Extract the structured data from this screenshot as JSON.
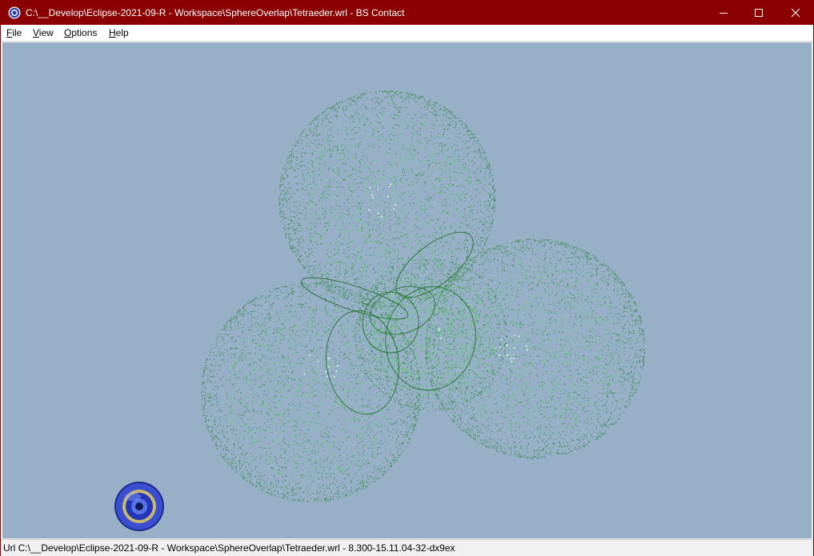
{
  "window": {
    "title": "C:\\__Develop\\Eclipse-2021-09-R - Workspace\\SphereOverlap\\Tetraeder.wrl - BS Contact",
    "icon": "bs-contact-logo-icon",
    "title_bar_color": "#8b0000"
  },
  "menu": {
    "items": [
      {
        "label_u": "F",
        "label_rest": "ile"
      },
      {
        "label_u": "V",
        "label_rest": "iew"
      },
      {
        "label_u": "O",
        "label_rest": "ptions"
      },
      {
        "label_u": "H",
        "label_rest": "elp"
      }
    ]
  },
  "viewport": {
    "background_color": "#97b0c8",
    "nav_icon": "navigation-target-icon"
  },
  "status": {
    "text": "Url C:\\__Develop\\Eclipse-2021-09-R - Workspace\\SphereOverlap\\Tetraeder.wrl  -  8.300-15.11.04-32-dx9ex"
  }
}
